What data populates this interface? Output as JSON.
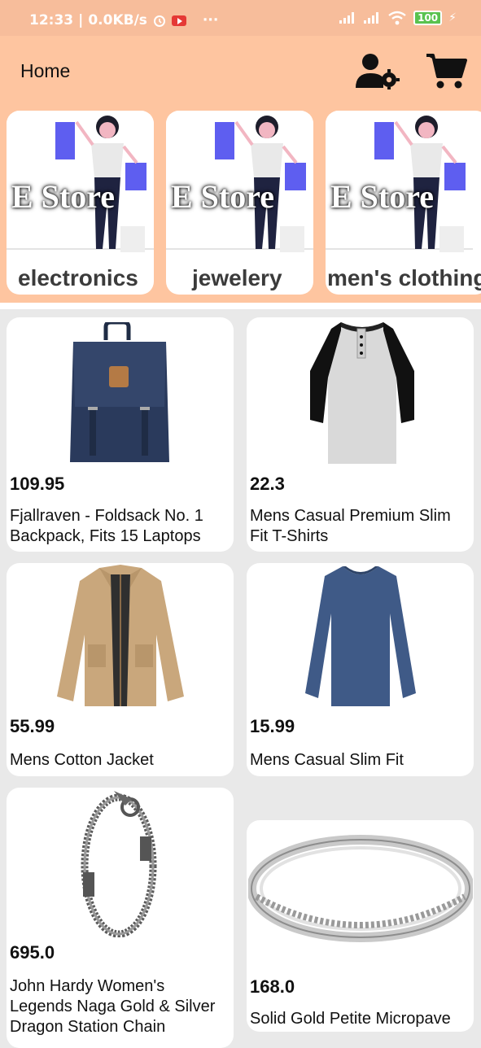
{
  "status_bar": {
    "time": "12:33",
    "speed": "0.0KB/s",
    "more": "···",
    "battery": "100",
    "icons": [
      "alarm-icon",
      "youtube-icon",
      "signal-icon",
      "signal-icon",
      "wifi-icon",
      "battery-icon",
      "charging-icon"
    ]
  },
  "appbar": {
    "title": "Home",
    "icons": [
      "user-settings-icon",
      "cart-icon"
    ],
    "background": "#fec5a0"
  },
  "banner_text": "E Store",
  "categories": [
    {
      "name": "electronics"
    },
    {
      "name": "jewelery"
    },
    {
      "name": "men's clothing"
    }
  ],
  "products": [
    {
      "price": "109.95",
      "name": "Fjallraven - Foldsack No. 1 Backpack, Fits 15 Laptops",
      "image": "backpack"
    },
    {
      "price": "22.3",
      "name": "Mens Casual Premium Slim Fit T-Shirts",
      "image": "raglan-tshirt"
    },
    {
      "price": "55.99",
      "name": "Mens Cotton Jacket",
      "image": "jacket"
    },
    {
      "price": "15.99",
      "name": "Mens Casual Slim Fit",
      "image": "long-sleeve-shirt"
    },
    {
      "price": "695.0",
      "name": "John Hardy Women's Legends Naga Gold & Silver Dragon Station Chain",
      "image": "bracelet"
    },
    {
      "price": "168.0",
      "name": "Solid Gold Petite Micropave",
      "image": "ring"
    }
  ]
}
